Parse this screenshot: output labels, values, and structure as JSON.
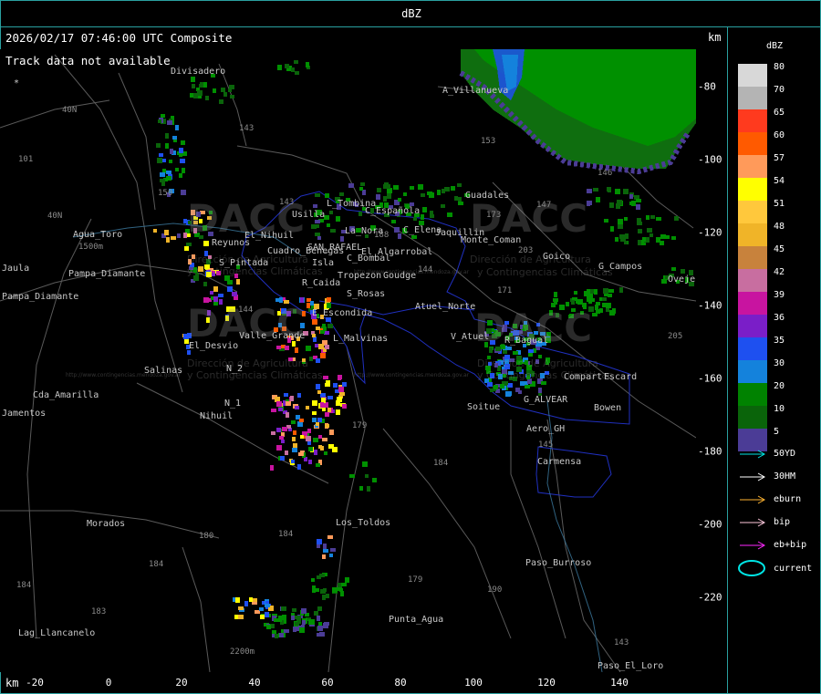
{
  "title": "dBZ",
  "header": "2026/02/17 07:46:00 UTC Composite",
  "track_message": "Track data not available",
  "km_label": "km",
  "x_ticks": [
    "-20",
    "0",
    "20",
    "40",
    "60",
    "80",
    "100",
    "120",
    "140"
  ],
  "y_ticks": [
    "-80",
    "-100",
    "-120",
    "-140",
    "-160",
    "-180",
    "-200",
    "-220"
  ],
  "legend": {
    "title": "dBZ",
    "colors": [
      {
        "label": "80",
        "color": "#d8d8d8"
      },
      {
        "label": "70",
        "color": "#b4b4b4"
      },
      {
        "label": "65",
        "color": "#ff3a1e"
      },
      {
        "label": "60",
        "color": "#ff5a00"
      },
      {
        "label": "57",
        "color": "#ff9a5a"
      },
      {
        "label": "54",
        "color": "#ffff00"
      },
      {
        "label": "51",
        "color": "#ffc83c"
      },
      {
        "label": "48",
        "color": "#f0b428"
      },
      {
        "label": "45",
        "color": "#c8823c"
      },
      {
        "label": "42",
        "color": "#c86ea0"
      },
      {
        "label": "39",
        "color": "#c814a0"
      },
      {
        "label": "36",
        "color": "#7a1ec8"
      },
      {
        "label": "35",
        "color": "#1e50f0"
      },
      {
        "label": "30",
        "color": "#1482dc"
      },
      {
        "label": "20",
        "color": "#008200"
      },
      {
        "label": "10",
        "color": "#0a640a"
      },
      {
        "label": "5",
        "color": "#4b3c96"
      }
    ],
    "tracks": [
      {
        "label": "50YD",
        "color": "#00e6e6"
      },
      {
        "label": "30HM",
        "color": "#ffffff"
      },
      {
        "label": "eburn",
        "color": "#ffb432"
      },
      {
        "label": "bip",
        "color": "#ffc8dc"
      },
      {
        "label": "eb+bip",
        "color": "#ff28ff"
      },
      {
        "label": "current",
        "color": "#00e6e6",
        "icon": "ellipse-icon"
      }
    ]
  },
  "places": [
    {
      "name": "Divisadero"
    },
    {
      "name": "A_Villanueva"
    },
    {
      "name": "Guadales"
    },
    {
      "name": "Agua_Toro"
    },
    {
      "name": "Reyunos"
    },
    {
      "name": "El_Nihuil"
    },
    {
      "name": "Usilla"
    },
    {
      "name": "L_Tombina"
    },
    {
      "name": "C_Española"
    },
    {
      "name": "La_Nora"
    },
    {
      "name": "C_Elena"
    },
    {
      "name": "Cuadro_Benegas"
    },
    {
      "name": "SAN_RAFAEL"
    },
    {
      "name": "El_Algarrobal"
    },
    {
      "name": "Isla"
    },
    {
      "name": "C_Bombal"
    },
    {
      "name": "S_Pintada"
    },
    {
      "name": "Tropezon"
    },
    {
      "name": "Goudge"
    },
    {
      "name": "R_Caida"
    },
    {
      "name": "S_Rosas"
    },
    {
      "name": "Atuel_Norte"
    },
    {
      "name": "E_Escondida"
    },
    {
      "name": "L_Malvinas"
    },
    {
      "name": "V_Atuel"
    },
    {
      "name": "R_Bagual"
    },
    {
      "name": "El_Desvio"
    },
    {
      "name": "Valle_Grande"
    },
    {
      "name": "Salinas"
    },
    {
      "name": "N_2"
    },
    {
      "name": "N_1"
    },
    {
      "name": "Nihuil"
    },
    {
      "name": "Cda_Amarilla"
    },
    {
      "name": "Pampa_Diamante"
    },
    {
      "name": "Pampa_Diamante"
    },
    {
      "name": "Jaula"
    },
    {
      "name": "Jamentos"
    },
    {
      "name": "Morados"
    },
    {
      "name": "Los_Toldos"
    },
    {
      "name": "Lag_Llancanelo"
    },
    {
      "name": "Punta_Agua"
    },
    {
      "name": "Paso_Burroso"
    },
    {
      "name": "Paso_El_Loro"
    },
    {
      "name": "Carmensa"
    },
    {
      "name": "Aero_GH"
    },
    {
      "name": "G_ALVEAR"
    },
    {
      "name": "Bowen"
    },
    {
      "name": "Compart"
    },
    {
      "name": "Escard"
    },
    {
      "name": "Soitue"
    },
    {
      "name": "Goico"
    },
    {
      "name": "G_Campos"
    },
    {
      "name": "Oveje"
    },
    {
      "name": "Jaquillin"
    },
    {
      "name": "Monte_Coman"
    }
  ],
  "road_numbers": [
    "143",
    "153",
    "146",
    "101",
    "40N",
    "40N",
    "150",
    "143",
    "173",
    "203",
    "171",
    "144",
    "144",
    "179",
    "184",
    "180",
    "184",
    "179",
    "190",
    "184",
    "183",
    "184",
    "143",
    "145",
    "205",
    "147",
    "188",
    "1500m",
    "2200m"
  ],
  "watermarks": {
    "logo": "DACC",
    "line1": "Dirección de Agricultura",
    "line2": "y Contingencias Climáticas",
    "url": "http://www.contingencias.mendoza.gov.ar"
  }
}
